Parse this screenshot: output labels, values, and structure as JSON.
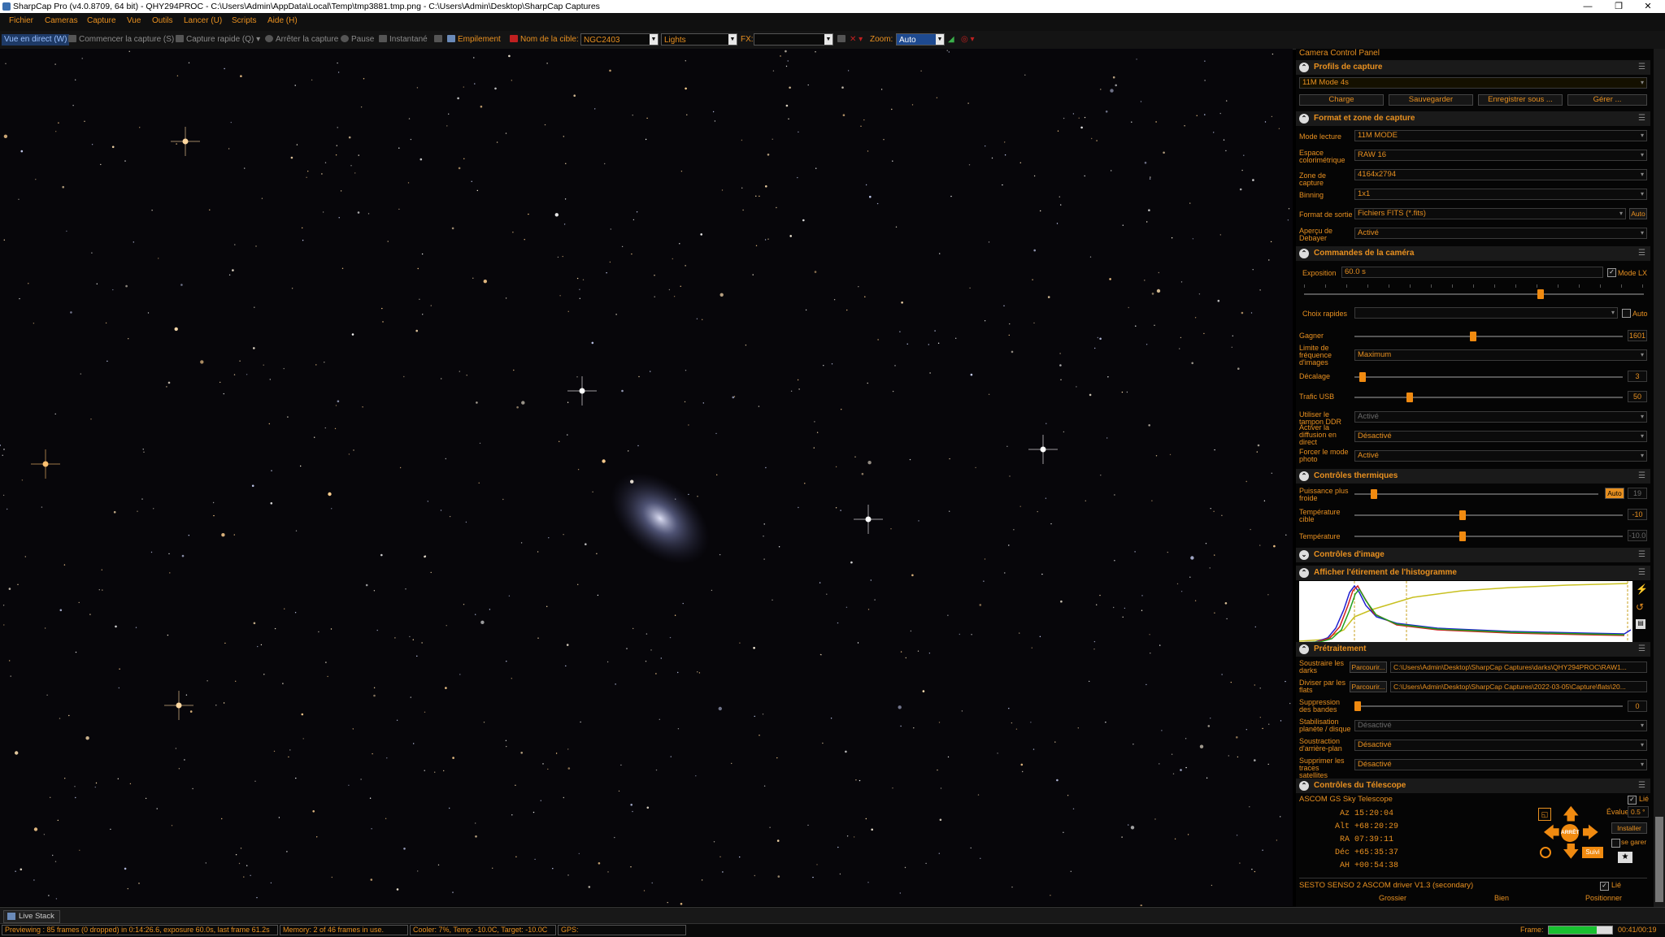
{
  "window": {
    "title": "SharpCap Pro (v4.0.8709, 64 bit) - QHY294PROC - C:\\Users\\Admin\\AppData\\Local\\Temp\\tmp3881.tmp.png - C:\\Users\\Admin\\Desktop\\SharpCap Captures",
    "minimize": "—",
    "maximize": "❐",
    "close": "✕"
  },
  "menu": [
    "Fichier",
    "Cameras",
    "Capture",
    "Vue",
    "Outils",
    "Lancer (U)",
    "Scripts",
    "Aide (H)"
  ],
  "toolbar": {
    "live_view": "Vue en direct (W)",
    "start_capture": "Commencer la capture (S)",
    "quick_capture": "Capture rapide (Q)",
    "stop_capture": "Arrêter la capture",
    "pause": "Pause",
    "snapshot": "Instantané",
    "stacking": "Empilement",
    "target_label": "Nom de la cible:",
    "target_value": "NGC2403",
    "frame_type": "Lights",
    "fx_label": "FX:",
    "fx_value": "",
    "zoom_label": "Zoom:",
    "zoom_value": "Auto"
  },
  "panel": {
    "title": "Camera Control Panel",
    "profiles": {
      "header": "Profils de capture",
      "selected": "11M Mode 4s",
      "buttons": [
        "Charge",
        "Sauvegarder",
        "Enregistrer sous ...",
        "Gérer ..."
      ]
    },
    "format": {
      "header": "Format et zone de capture",
      "rows": [
        {
          "label": "Mode lecture",
          "value": "11M MODE"
        },
        {
          "label": "Espace colorimétrique",
          "value": "RAW 16"
        },
        {
          "label": "Zone de capture",
          "value": "4164x2794"
        },
        {
          "label": "Binning",
          "value": "1x1"
        },
        {
          "label": "Format de sortie",
          "value": "Fichiers FITS (*.fits)",
          "extra": "Auto"
        },
        {
          "label": "Aperçu de Debayer",
          "value": "Activé"
        }
      ]
    },
    "camera": {
      "header": "Commandes de la caméra",
      "exposure_label": "Exposition",
      "exposure_value": "60.0 s",
      "lx_mode": "Mode LX",
      "quick_choice": "Choix rapides",
      "auto": "Auto",
      "gain_label": "Gagner",
      "gain_value": "1601",
      "gain_level": 0.44,
      "fps_label": "Limite de fréquence d'images",
      "fps_value": "Maximum",
      "offset_label": "Décalage",
      "offset_value": "3",
      "offset_level": 0.02,
      "usb_label": "Trafic USB",
      "usb_value": "50",
      "usb_level": 0.2,
      "ddr_label": "Utiliser le tampon DDR",
      "ddr_value": "Activé",
      "stream_label": "Activer la diffusion en direct",
      "stream_value": "Désactivé",
      "photo_label": "Forcer le mode photo",
      "photo_value": "Activé",
      "exposure_level": 0.7
    },
    "thermal": {
      "header": "Contrôles thermiques",
      "power_label": "Puissance plus froide",
      "power_value": "19",
      "power_auto": "Auto",
      "power_level": 0.07,
      "target_label": "Température cible",
      "target_value": "-10",
      "target_level": 0.4,
      "temp_label": "Température",
      "temp_value": "-10.0",
      "temp_level": 0.4
    },
    "image_controls": {
      "header": "Contrôles d'image"
    },
    "histogram": {
      "header": "Afficher l'étirement de l'histogramme"
    },
    "preprocessing": {
      "header": "Prétraitement",
      "darks_label": "Soustraire les darks",
      "darks_browse": "Parcourir...",
      "darks_path": "C:\\Users\\Admin\\Desktop\\SharpCap Captures\\darks\\QHY294PROC\\RAW1...",
      "flats_label": "Diviser par les flats",
      "flats_browse": "Parcourir...",
      "flats_path": "C:\\Users\\Admin\\Desktop\\SharpCap Captures\\2022-03-05\\Capture\\flats\\20...",
      "banding_label": "Suppression des bandes",
      "banding_value": "0",
      "banding_level": 0.0,
      "stab_label": "Stabilisation planète / disque",
      "stab_value": "Désactivé",
      "bg_label": "Soustraction d'arrière-plan",
      "bg_value": "Désactivé",
      "sat_label": "Supprimer les traces satellites",
      "sat_value": "Désactivé"
    },
    "telescope": {
      "header": "Contrôles du Télescope",
      "mount": "ASCOM GS Sky Telescope",
      "linked": "Lié",
      "rows": [
        {
          "label": "Az",
          "value": "15:20:04"
        },
        {
          "label": "Alt",
          "value": "+68:20:29"
        },
        {
          "label": "RA",
          "value": "07:39:11"
        },
        {
          "label": "Déc",
          "value": "+65:35:37"
        },
        {
          "label": "AH",
          "value": "+00:54:38"
        }
      ],
      "rate_label": "Évaluer:",
      "rate_value": "0.5 °",
      "install": "Installer",
      "park": "se garer",
      "follow": "Suivi",
      "center": "ARRÊT",
      "focuser": "SESTO SENSO 2 ASCOM driver V1.3 (secondary)",
      "focuser_linked": "Lié",
      "focus_cols": [
        "Grossier",
        "Bien",
        "Positionner"
      ]
    }
  },
  "bottom": {
    "tab": "Live Stack"
  },
  "status": {
    "preview": "Previewing : 85 frames (0 dropped) in 0:14:26.6, exposure 60.0s, last frame 61.2s",
    "memory": "Memory: 2 of 46 frames in use.",
    "cooler": "Cooler: 7%, Temp: -10.0C, Target: -10.0C",
    "gps": "GPS:",
    "frame_label": "Frame:",
    "frame_time": "00:41/00:19",
    "frame_progress": 0.75
  },
  "colors": {
    "accent": "#e89020",
    "knob": "#f08a10",
    "background": "#000000"
  }
}
